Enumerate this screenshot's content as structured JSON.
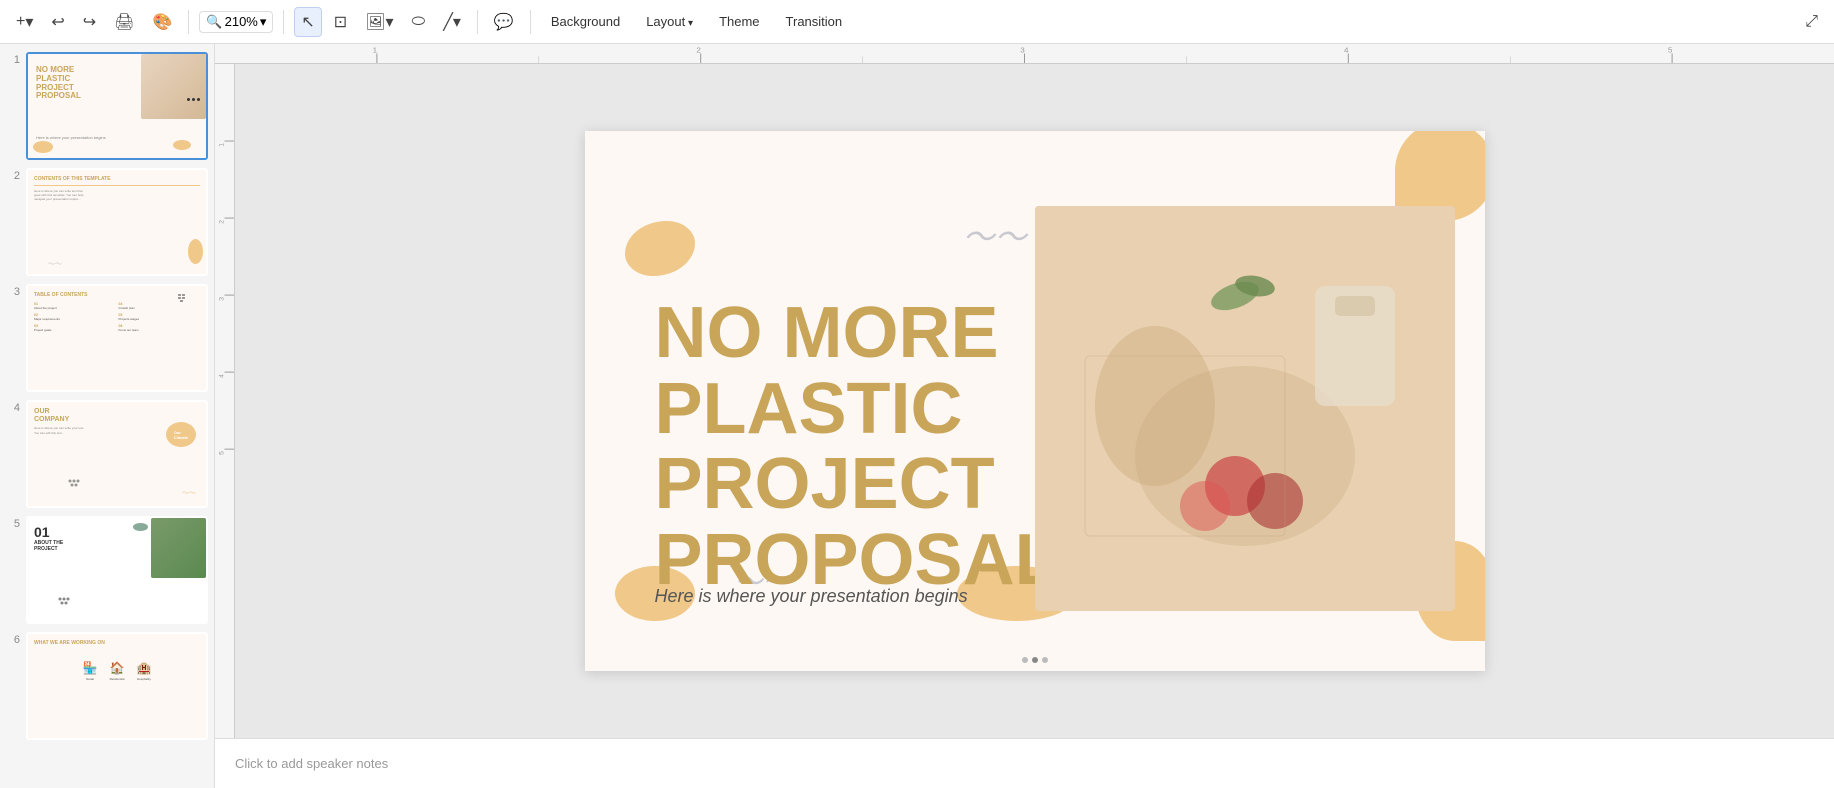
{
  "toolbar": {
    "add_label": "+",
    "undo_label": "↩",
    "redo_label": "↪",
    "print_label": "🖨",
    "paint_label": "🎨",
    "zoom_label": "🔍",
    "zoom_value": "210%",
    "cursor_label": "↖",
    "text_label": "T",
    "image_label": "🖼",
    "shape_label": "○",
    "line_label": "/",
    "comment_label": "💬",
    "background_label": "Background",
    "layout_label": "Layout",
    "theme_label": "Theme",
    "transition_label": "Transition",
    "maximize_label": "⤢"
  },
  "slides": [
    {
      "num": "1",
      "selected": true
    },
    {
      "num": "2",
      "selected": false
    },
    {
      "num": "3",
      "selected": false
    },
    {
      "num": "4",
      "selected": false
    },
    {
      "num": "5",
      "selected": false
    },
    {
      "num": "6",
      "selected": false
    }
  ],
  "slide1": {
    "title_line1": "NO MORE",
    "title_line2": "PLASTIC",
    "title_line3": "PROJECT",
    "title_line4": "PROPOSAL",
    "subtitle": "Here is where your presentation begins"
  },
  "slide2": {
    "title": "CONTENTS OF THIS TEMPLATE"
  },
  "slide3": {
    "title": "TABLE OF CONTENTS",
    "items": [
      {
        "num": "01",
        "label": "About the project"
      },
      {
        "num": "04",
        "label": "Growth plan"
      },
      {
        "num": "02",
        "label": "Major requirements"
      },
      {
        "num": "05",
        "label": "Projects stages"
      },
      {
        "num": "03",
        "label": "Project goals"
      },
      {
        "num": "06",
        "label": "Know our team"
      }
    ]
  },
  "slide4": {
    "title": "OUR\nCOMPANY",
    "badge": "Our Climate"
  },
  "slide5": {
    "num": "01",
    "title": "ABOUT THE\nPROJECT"
  },
  "slide6": {
    "title": "WHAT WE ARE WORKING ON",
    "items": [
      {
        "icon": "🏪",
        "label": "Retail"
      },
      {
        "icon": "🏠",
        "label": "Residential"
      },
      {
        "icon": "🏨",
        "label": "Hospitality"
      }
    ]
  },
  "speaker_notes": {
    "placeholder": "Click to add speaker notes"
  }
}
